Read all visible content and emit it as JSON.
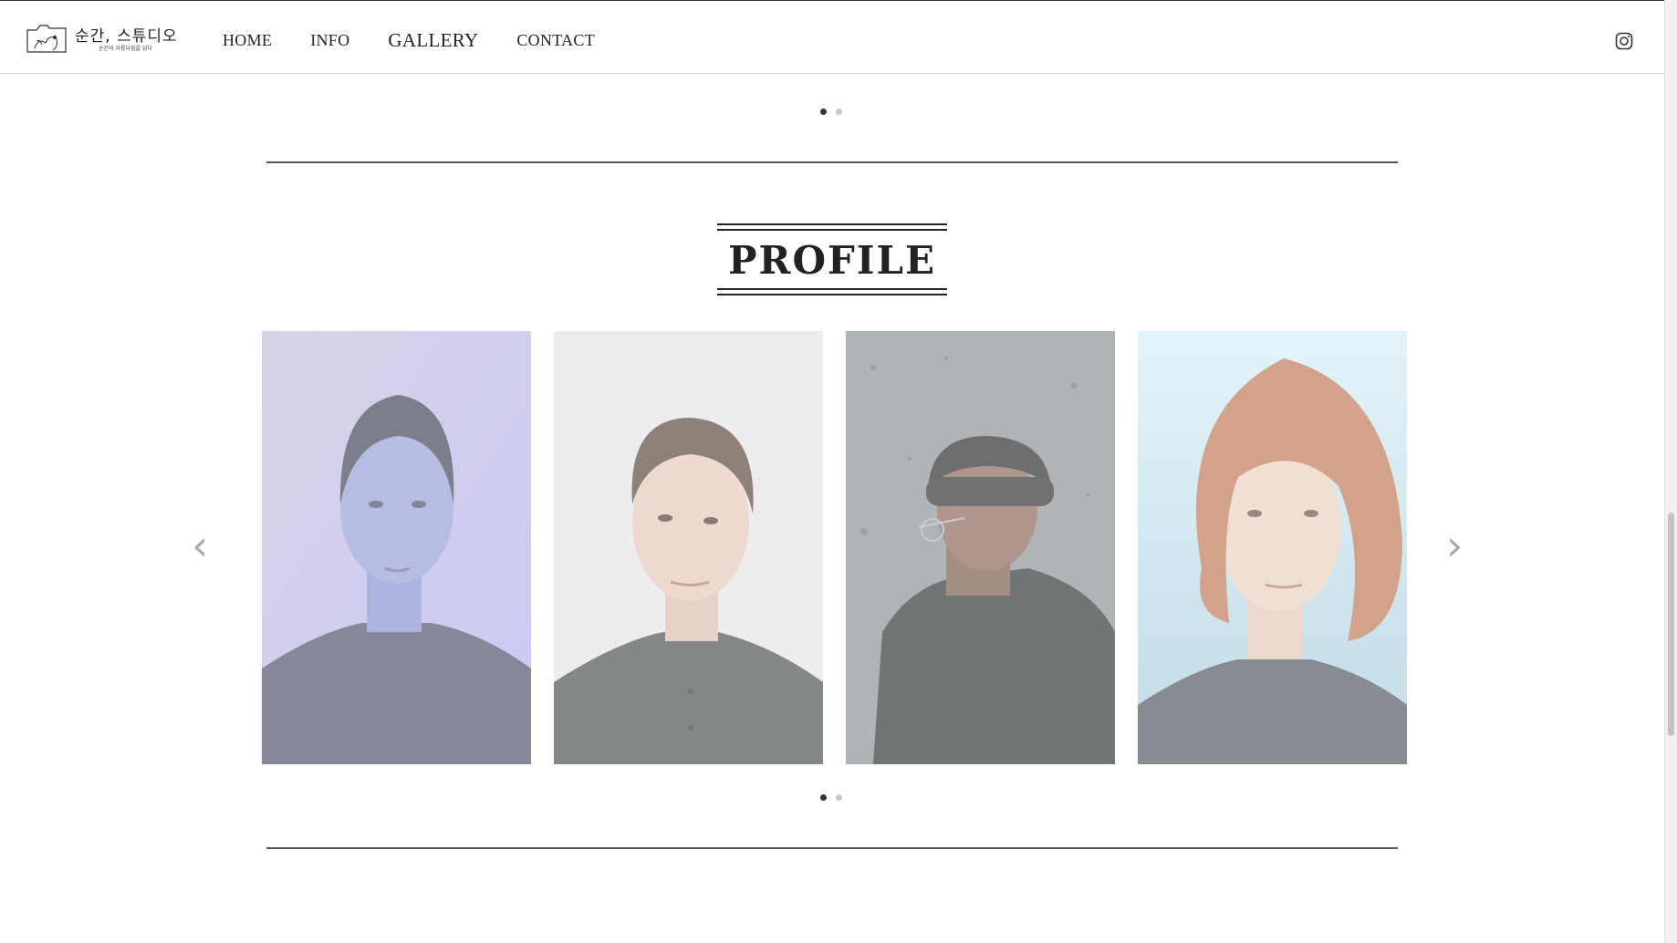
{
  "header": {
    "logo_title": "순간, 스튜디오",
    "logo_subtitle": "순간의 아름다움을 담다",
    "nav": [
      {
        "label": "HOME"
      },
      {
        "label": "INFO"
      },
      {
        "label": "GALLERY",
        "active": true
      },
      {
        "label": "CONTACT"
      }
    ],
    "social_icon": "instagram-icon"
  },
  "top_carousel": {
    "dots": 2,
    "active_dot": 1
  },
  "profile_section": {
    "title": "PROFILE",
    "prev_arrow": "‹",
    "next_arrow": "›",
    "cards": [
      {
        "subject": "woman-blue-light-portrait",
        "background": "#c9c6dc"
      },
      {
        "subject": "man-grey-shirt-portrait",
        "background": "#e4e3e6"
      },
      {
        "subject": "man-beanie-glasses-portrait",
        "background": "#8b9196"
      },
      {
        "subject": "redhead-woman-portrait",
        "background": "#d6ebf4"
      }
    ],
    "dots": 2,
    "active_dot": 1
  },
  "colors": {
    "text": "#222222",
    "divider": "#555555",
    "arrow": "#aaaaaa"
  }
}
